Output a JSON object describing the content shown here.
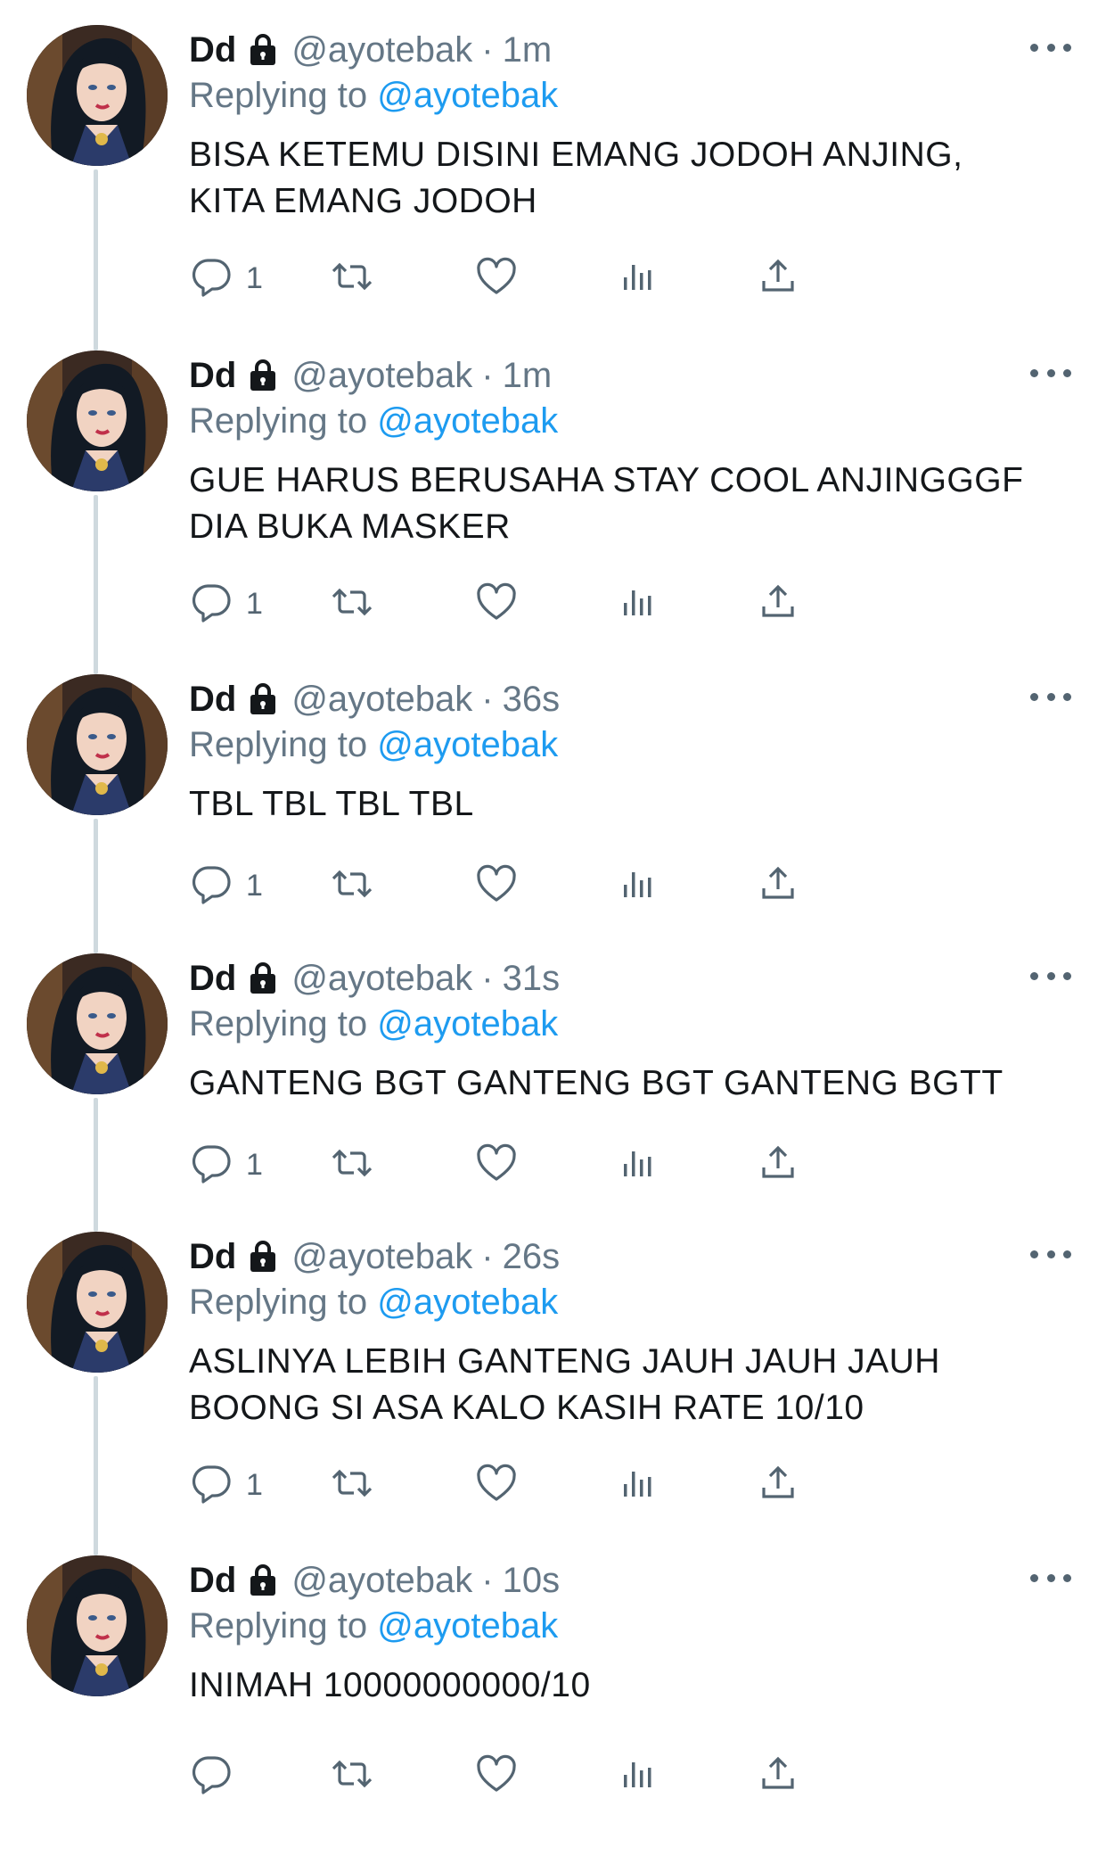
{
  "tweets": [
    {
      "name": "Dd",
      "handle": "@ayotebak",
      "separator": "·",
      "time": "1m",
      "replying_prefix": "Replying to",
      "replying_to": "@ayotebak",
      "text": "BISA KETEMU DISINI EMANG JODOH ANJING,\nKITA EMANG JODOH",
      "reply_count": "1"
    },
    {
      "name": "Dd",
      "handle": "@ayotebak",
      "separator": "·",
      "time": "1m",
      "replying_prefix": "Replying to",
      "replying_to": "@ayotebak",
      "text": "GUE HARUS BERUSAHA STAY COOL ANJINGGGF\nDIA BUKA MASKER",
      "reply_count": "1"
    },
    {
      "name": "Dd",
      "handle": "@ayotebak",
      "separator": "·",
      "time": "36s",
      "replying_prefix": "Replying to",
      "replying_to": "@ayotebak",
      "text": "TBL TBL TBL TBL",
      "reply_count": "1"
    },
    {
      "name": "Dd",
      "handle": "@ayotebak",
      "separator": "·",
      "time": "31s",
      "replying_prefix": "Replying to",
      "replying_to": "@ayotebak",
      "text": "GANTENG BGT GANTENG BGT GANTENG BGTT",
      "reply_count": "1"
    },
    {
      "name": "Dd",
      "handle": "@ayotebak",
      "separator": "·",
      "time": "26s",
      "replying_prefix": "Replying to",
      "replying_to": "@ayotebak",
      "text": "ASLINYA LEBIH GANTENG JAUH JAUH JAUH\nBOONG SI ASA KALO KASIH RATE 10/10",
      "reply_count": "1"
    },
    {
      "name": "Dd",
      "handle": "@ayotebak",
      "separator": "·",
      "time": "10s",
      "replying_prefix": "Replying to",
      "replying_to": "@ayotebak",
      "text": "INIMAH 10000000000/10",
      "reply_count": ""
    }
  ],
  "icons": {
    "lock": "lock-icon",
    "more": "more-icon",
    "reply": "reply-icon",
    "retweet": "retweet-icon",
    "like": "heart-icon",
    "views": "views-icon",
    "share": "share-icon"
  },
  "colors": {
    "link": "#1d9bf0",
    "secondary": "#657786",
    "text": "#14171a",
    "thread_line": "#cfd9de"
  }
}
